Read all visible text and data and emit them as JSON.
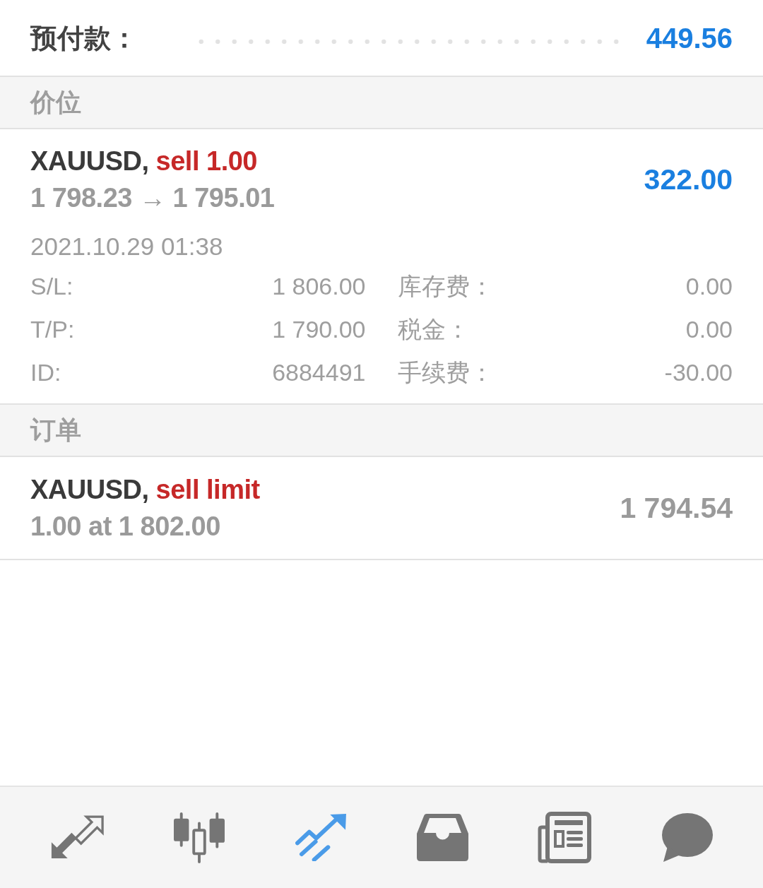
{
  "summary": {
    "label": "预付款：",
    "value": "449.56"
  },
  "sections": [
    {
      "title": "价位",
      "items": [
        {
          "kind": "position",
          "symbol": "XAUUSD,",
          "action": "sell 1.00",
          "prices": "1 798.23 → 1 795.01",
          "amount": "322.00",
          "time": "2021.10.29 01:38",
          "details": [
            {
              "label": "S/L:",
              "value": "1 806.00"
            },
            {
              "label": "库存费：",
              "value": "0.00"
            },
            {
              "label": "T/P:",
              "value": "1 790.00"
            },
            {
              "label": "税金：",
              "value": "0.00"
            },
            {
              "label": "ID:",
              "value": "6884491"
            },
            {
              "label": "手续费：",
              "value": "-30.00"
            }
          ]
        }
      ]
    },
    {
      "title": "订单",
      "items": [
        {
          "kind": "order",
          "symbol": "XAUUSD,",
          "action": "sell limit",
          "prices": "1.00 at 1 802.00",
          "amount": "1 794.54"
        }
      ]
    }
  ],
  "bottom_nav": [
    {
      "selected": false
    },
    {
      "selected": false
    },
    {
      "selected": true
    },
    {
      "selected": false
    },
    {
      "selected": false
    },
    {
      "selected": false
    }
  ]
}
